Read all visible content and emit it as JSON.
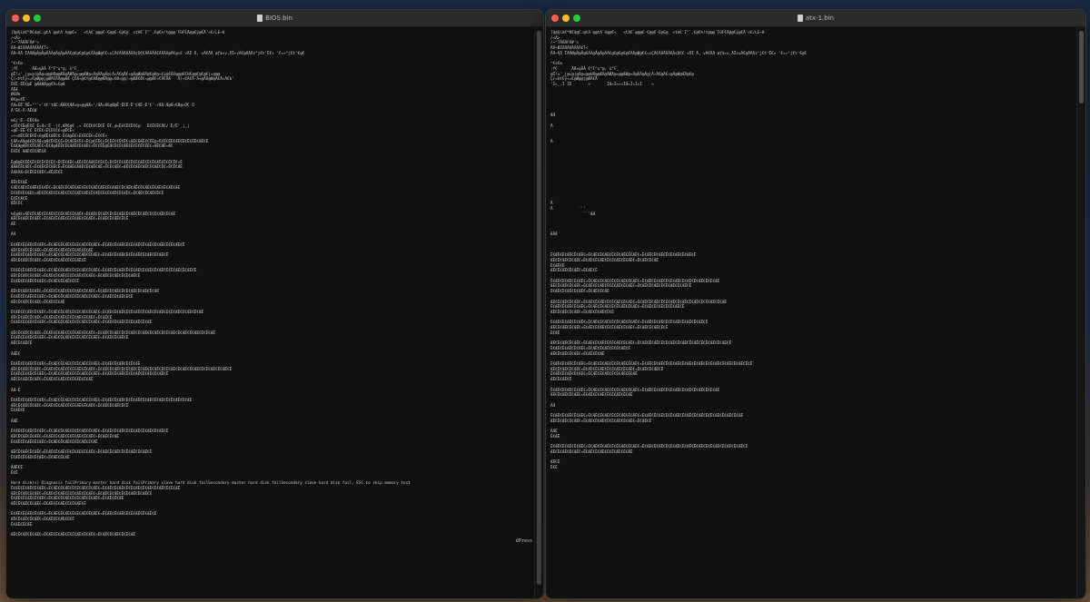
{
  "left_window": {
    "title": "BIOS.bin",
    "lines": [
      "[Q@§iâ€™R€d@C:@tA`@@tA`A@@€<   <tA€`@@@€-€@@€-€@€@  <tA€`I\"`‚€@€%!t@@@`FOF€Ä@@€ÿ@€Ä'<€/LE~8",
      "/<Ã>",
      "/~^7ÂÂÂFÂ#'<",
      "ÄÄ~ØIÂÄÂÄÂÂÂÂ€T<",
      "ÂÄ~ÂÄ ÏÃÂØ@Å@Å@ÂÂÂ@Å@Â@ÂÂ€@€@€@€@€ÂÂ@Ø@€€«±ÇÂ€ÂÂÄÂÂÄÂ¢D€€ÂÂÂÂÂ€ÄÄÄÂ@Ä€@«€ vÄÏ Ä, vÂ€ÄÄ øƒ$«v,ÄÏ«vÂ€@ÄÄÄz°j€t'Ë€« '€«»°j€t'€@€",
      "",
      "^€s€m",
      ";f€      ÄÆ¤qÂÂ €^F^u^@, ü^F_",
      "@Ï!v'_|@«@|@Ä@«@@HÄ@@ÆÄ@ÄØÄ@«@@ÆØ@«Ä@ÂÄ@Ä@|Ä«Ä€@Ä€«@Ä@Ø@ÆÂ@€@Ä@«€ÿ@€ÂÄ@@@€€H€@@€@€@€|«@@@",
      "Ç(«Þt€ÿ«=€@Ø@@|@ØÂ€ÄÄ@@ÆÆ Ç€Æ«@€f@€ÆÆ@@ÆÄ@@=€Ø«@@|«@ÆÆ€Æ€«@@Æ€«€Ä€ÄÆ   Ä(«€Ä€Ä-Ä«@ÄÄ@Ø@Ä€Ä«Ä€b'",
      "Ë€Ë-ËË€@Ë @ÆÆØÆ@@€Ä«€@Æ",
      "ÄËÆ",
      "Ø€Øk",
      "Ø€@«€Ë",
      "ÄÆ«ÉË`ÄË«'\"'«'t€'tÆ€:ÆÆ€€ÆÆ«@«@@ÆÆ«'/ÆÄ«Æ€@Ø@Ê'Ë€Ë-Ë'€ÆË-Ë'€'-/ÆÆ-Æ@Æ«€Ø@«Ü€ Ü",
      "Ä'Ë€-Ä-ÄË€Ø",
      "",
      "m€ç'Ë.-ËË€Æe",
      "«€Ë€€Ë@Ë€Ë Ë«Æ«'Ë -|t,ÆÄ€@€ ,«`Ë€Ë€€€Ë€Ë Ë€.@«Ë€€Ë€Ë€€@   Ë€Ë€Ë€Ä€/ Ë/Ë'_|_|",
      "«@Ë-ËË-€€ Ë€Ë€«Ë€Ë€€€«@Ë€Ë«",
      "«+«®Ë€Ë€Ë€Ë«€@ÆË€ÆË€€ Ë€Æ@Ë€«Ë€Ë€Ë€«Ë€€Ë«",
      "€ÆÄ«ÆÆ@Æ€Ë€ÆÆ«@Æ€Ë€Ë€Ë«Ë€ÆËË€Ë€«Ë€@€ËË€«Ë€ËË€€Ë€Ë€«ÆË€ËÆË€€ËË@«Ë€Ë€ËË€ÆË€Ë€Ë€ËË€ÆË€Ë",
      "Ë€ÆÆ@ÆË€€Ë€ÆË€«Ë€Æ@ÆËË€Ë€ÆÆË€Ë€ÆË€«Ë€€ËË@ËÆ€Ë€Ë€ÆË€Ë€Ë€Ë€ËË€«ÆË€ÆË«Æ€",
      "Ë€Ë€ ÆÆË€Ë€ÆË€Æ",
      "",
      "Ë@Ø@Ë€ËË€Ë€Ë€Ë€Ë€Ë€«Ë€Ë€ÆË€«ÆË€Ë€ÆÆ€Ë€Ë€Ë«Ë€Ë€Ë€ÆË€Ë€Ë€ÆË€Ë€Ë€ÆË€Ë€Ë€Ë€«Ë",
      "ÆÆÆ€Ë€ÆË€«Ë€ÆË€Ë€ÆË€Ë«Ë€ÆÆË€ÆÆË€Ë€ÆË€ÆË«Ë€Ë€ÆË€«ÆË€Ë€ÆË€ÆË€Ë€ÆË€Ë€«Ë€Ë€ÆË",
      "ÂÆÆÂÆ«Ë€Ë€Ë€ÆË€«ÆË€Ë€Ë",
      "",
      "ÆË€Ë€ÆË",
      "€ÆË€ÆË€Ë€ÆË€Ë€ÆË€«Ë€ÆË€Ë€ÆË€ÆË€Ë€Ë€ÆË€ÆË€Ë€ÆÆË€Ë€ÆË€ÆË€Ë€ÆË€Ë€ÆË€Ë€ÆË€ÆË",
      "Ë€ÆË€Ë€ÆË€«ÆË€Ë€ÆË€Ë€ÆË€Ë€Ë€ÆË€ÆË€Ë€ÆË€Ë€Ë€ÆË€Ë€ÆË€«Ë€ÆË€Ë€ÆË€Ë€Ë",
      "Ë€Ë€Æ€Ë",
      "ÆË€Ë€",
      "",
      "%€@Æ€«ÆË€Ë€ÆË€Ë€ÆË€Ë€Ë€ÆË€Ë€ÆË€«Ë€ÆË€Ë€ÆË€Ë€Ë€ÆË€Ë€ÆË€Ë€ÆË€Ë€Ë€ÆË€Ë€ÆË",
      "ÆË€Ë€ÆË€Ë€ÆË€«Ë€ÆË€Ë€ÆË€Ë€Ë€ÆË€Ë€ÆË€«Ë€ÆË€Ë€ÆË€Ë€Ë",
      "ÆË",
      "",
      "ÂÆ",
      "",
      "Ë€ÆË€Ë€ÆË€Ë€ÆË€«Ë€ÆË€Ë€ÆË€Ë€Ë€ÆË€Ë€ÆË€«Ë€ÆË€Ë€ÆË€Ë€Ë€ÆË€Ë€ÆË€Ë€ÆË€Ë€Ë€ÆË€Ë",
      "ÆË€Ë€ÆË€Ë€ÆË€«Ë€ÆË€Ë€ÆË€Ë€Ë€ÆË€Ë€ÆË",
      "Ë€ÆË€Ë€ÆË€Ë€ÆË€«Ë€ÆË€Ë€ÆË€Ë€Ë€ÆË€Ë€ÆË€«Ë€ÆË€Ë€ÆË€Ë€Ë€ÆË€Ë€ÆË€Ë€ÆË€Ë",
      "ÆË€Ë€ÆË€Ë€ÆË€«Ë€ÆË€Ë€ÆË€Ë€Ë€ÆË€Ë",
      "",
      "Ë€ÆË€Ë€ÆË€Ë€ÆË€«Ë€ÆË€Ë€ÆË€Ë€Ë€ÆË€Ë€ÆË€«Ë€ÆË€Ë€ÆË€Ë€Ë€ÆË€Ë€ÆË€Ë€ÆË€Ë€Ë€ÆË€Ë€ÆË€Ë",
      "ÆË€Ë€ÆË€Ë€ÆË€«Ë€ÆË€Ë€ÆË€Ë€Ë€ÆË€Ë€ÆË€«Ë€ÆË€Ë€ÆË€Ë€Ë€ÆË€Ë",
      "Ë€ÆË€Ë€ÆË€Ë€ÆË€«Ë€ÆË€Ë€ÆË€Ë€Ë",
      "",
      "ÆË€Ë€ÆË€Ë€ÆË€«Ë€ÆË€Ë€ÆË€Ë€Ë€ÆË€Ë€ÆË€«Ë€ÆË€Ë€ÆË€Ë€Ë€ÆË€Ë€ÆË€Ë€ÆË",
      "Ë€ÆË€Ë€ÆË€Ë€ÆË€«Ë€ÆË€Ë€ÆË€Ë€Ë€ÆË€Ë€ÆË€«Ë€ÆË€Ë€ÆË€Ë€Ë",
      "ÆË€Ë€ÆË€Ë€ÆË€«Ë€ÆË€Ë€ÆË",
      "",
      "Ë€ÆË€Ë€ÆË€Ë€ÆË€«Ë€ÆË€Ë€ÆË€Ë€Ë€ÆË€Ë€ÆË€«Ë€ÆË€Ë€ÆË€Ë€Ë€ÆË€Ë€ÆË€Ë€ÆË€Ë€Ë€ÆË€Ë€ÆË€Ë€ÆË",
      "ÆË€Ë€ÆË€Ë€ÆË€«Ë€ÆË€Ë€ÆË€Ë€Ë€ÆË€Ë€ÆË€«Ë€ÆË€Ë",
      "Ë€ÆË€Ë€ÆË€Ë€ÆË€«Ë€ÆË€Ë€ÆË€Ë€Ë€ÆË€Ë€ÆË€«Ë€ÆË€Ë€ÆË€Ë€Ë€ÆË€Ë€ÆË",
      "",
      "ÆË€Ë€ÆË€Ë€ÆË€«Ë€ÆË€Ë€ÆË€Ë€Ë€ÆË€Ë€ÆË€«Ë€ÆË€Ë€ÆË€Ë€Ë€ÆË€Ë€ÆË€Ë€ÆË€Ë€Ë€ÆË€Ë€ÆË€Ë€ÆË€Ë€Ë€ÆË",
      "Ë€ÆË€Ë€ÆË€Ë€ÆË€«Ë€ÆË€Ë€ÆË€Ë€Ë€ÆË€Ë€ÆË€«Ë€ÆË€Ë€ÆË€Ë",
      "ÆË€Ë€ÆË€Ë",
      "",
      "ÂÆË€",
      "",
      "Ë€ÆË€Ë€ÆË€Ë€ÆË€«Ë€ÆË€Ë€ÆË€Ë€Ë€ÆË€Ë€ÆË€«Ë€ÆË€Ë€ÆË€Ë€Ë€ÆË",
      "ÆË€Ë€ÆË€Ë€ÆË€«Ë€ÆË€Ë€ÆË€Ë€Ë€ÆË€Ë€ÆË€«Ë€ÆË€Ë€ÆË€Ë€Ë€ÆË€Ë€ÆË€Ë€ÆË€Ë€Ë€ÆË€Ë€ÆË€Ë€ÆË€Ë€Ë€ÆË€Ë€ÆË€Ë",
      "Ë€ÆË€Ë€ÆË€Ë€ÆË€«Ë€ÆË€Ë€ÆË€Ë€Ë€ÆË€Ë€ÆË€«Ë€ÆË€Ë€ÆË€Ë€Ë€ÆË€Ë€ÆË€Ë€ÆË€Ë",
      "ÆË€Ë€ÆË€Ë€ÆË€«Ë€ÆË€Ë€ÆË€Ë€Ë€ÆË€Ë€ÆË",
      "",
      "ÂÆ-Ë",
      "",
      "Ë€ÆË€Ë€ÆË€Ë€ÆË€«Ë€ÆË€Ë€ÆË€Ë€Ë€ÆË€Ë€ÆË€«Ë€ÆË€Ë€ÆË€Ë€Ë€ÆË€Ë€ÆË€Ë€ÆË€Ë€Ë€ÆË€Ë€ÆË",
      "ÆË€Ë€ÆË€Ë€ÆË€«Ë€ÆË€Ë€ÆË€Ë€Ë€ÆË€Ë€ÆË€«Ë€ÆË€Ë€ÆË€Ë€Ë",
      "Ë€ÆË€Ë",
      "",
      "ÂÆË",
      "",
      "Ë€ÆË€Ë€ÆË€Ë€ÆË€«Ë€ÆË€Ë€ÆË€Ë€Ë€ÆË€Ë€ÆË€«Ë€ÆË€Ë€ÆË€Ë€Ë€ÆË€Ë€ÆË€Ë€ÆË€Ë",
      "ÆË€Ë€ÆË€Ë€ÆË€«Ë€ÆË€Ë€ÆË€Ë€Ë€ÆË€Ë€ÆË€«Ë€ÆË€Ë€ÆË",
      "Ë€ÆË€Ë€ÆË€Ë€ÆË€«Ë€ÆË€Ë€ÆË€Ë€Ë€ÆË€Ë€ÆË",
      "",
      "ÆË€Ë€ÆË€Ë€ÆË€«Ë€ÆË€Ë€ÆË€Ë€Ë€ÆË€Ë€ÆË€«Ë€ÆË€Ë€ÆË€Ë€Ë€ÆË€Ë€ÆË€Ë",
      "Ë€ÆË€Ë€ÆË€Ë€ÆË€«Ë€ÆË€Ë€ÆË",
      "",
      "ÂÆË€Ë",
      "Ë€Ë",
      "",
      "Hard disk(s) Diagnosis failPrimary master hard disk failPrimary slave hard disk failSecondary master hard disk failSecondary slave hard disk fail, ESC to skip memory test",
      "Ë€ÆË€Ë€ÆË€Ë€ÆË€«Ë€ÆË€Ë€ÆË€Ë€Ë€ÆË€Ë€ÆË€«Ë€ÆË€Ë€ÆË€Ë€Ë€ÆË€Ë€ÆË€Ë€ÆË€Ë€Ë€ÆË",
      "ÆË€Ë€ÆË€Ë€ÆË€«Ë€ÆË€Ë€ÆË€Ë€Ë€ÆË€Ë€ÆË€«Ë€ÆË€Ë€ÆË€Ë€Ë€ÆË€Ë€ÆË€Ë",
      "Ë€ÆË€Ë€ÆË€Ë€ÆË€«Ë€ÆË€Ë€ÆË€Ë€Ë€ÆË€Ë€ÆË€«Ë€ÆË€Ë€ÆË",
      "ÆË€Ë€ÆË€Ë€ÆË€«Ë€ÆË€Ë€ÆË€Ë€Ë€ÆË€Ë",
      "",
      "Ë€ÆË€Ë€ÆË€Ë€ÆË€«Ë€ÆË€Ë€ÆË€Ë€Ë€ÆË€Ë€ÆË€«Ë€ÆË€Ë€ÆË€Ë€Ë€ÆË€Ë€ÆË€Ë",
      "ÆË€Ë€ÆË€Ë€ÆË€«Ë€ÆË€Ë€ÆË€Ë€Ë",
      "Ë€ÆË€Ë€ÆË",
      "",
      "ÆË€Ë€ÆË€Ë€ÆË€«Ë€ÆË€Ë€ÆË€Ë€Ë€ÆË€Ë€ÆË€«Ë€ÆË€Ë€ÆË€Ë€Ë€ÆË"
    ],
    "footnote": "©Press"
  },
  "right_window": {
    "title": "atx-1.bin",
    "lines": [
      "[Q@§iâ€™R€d@C:@tA`@@tA`A@@€<   <tA€`@@@€-€@@€-€@€@  <tA€`I\"`‚€@€%!t@@@`FOF€Ä@@€ÿ@€Ä'<€/LE~8",
      "/<Ã>",
      "/~^7ÂÂÂFÂ#'<",
      "ÄÄ~ØIÂÄÂÄÂÂÂÂ€T<",
      "ÂÄ~ÂÄ ÏÃÂØ@Å@Å@ÂÂÂ@Å@Â@ÂÂ€@€@€@€@€ÂÂ@Ø@€€«±ÇÂ€ÂÂÄÂÂÄÂ¢D€€ vÄÏ Ä, vÂ€ÄÄ øƒ$«v,ÄÏ«vÂ€@ÄÄÄz°j€t'Ë€« '€«»°j€t'€@€",
      "",
      "^€s€m",
      ";f€      ÄÆ¤qÂÂ €^F^u^@, ü^F_",
      "@Ï!v'_|@«@|@Ä@«@@HÄ@@ÆÄ@ÄØÄ@«@@ÆØ@«Ä@ÂÄ@Ä@|Ä«Ä€@Ä€«@Ä@Ø@ÆÂ@€@",
      "Ç(«Þt€ÿ«=€@Ø@@|@ØÂ€Ä",
      "'Ì«_.Ì ÌË       >       ÌÆ«Ì«««ÌÆ«Ì«Ì«Ì    «",
      "",
      "",
      "",
      "",
      "",
      "ÆÆ",
      "",
      "Ä",
      "",
      "",
      "Ä",
      "",
      "",
      "",
      "",
      "",
      "",
      "",
      "",
      "",
      "",
      "",
      "Ä",
      "Ä           ``'",
      "              ``'ÆÆ",
      "",
      "",
      "",
      "ÆÂÆ",
      "",
      "",
      "",
      "Ë€ÆË€Ë€ÆË€Ë€ÆË€«Ë€ÆË€Ë€ÆË€Ë€Ë€ÆË€Ë€ÆË€«Ë€ÆË€Ë€ÆË€Ë€Ë€ÆË€Ë€ÆË€Ë",
      "ÆË€Ë€ÆË€Ë€ÆË€«Ë€ÆË€Ë€ÆË€Ë€Ë€ÆË€Ë€ÆË€«Ë€ÆË€Ë€ÆË",
      "Ë€ÆË€Ë",
      "ÆË€Ë€ÆË€Ë€ÆË€«Ë€ÆË€Ë",
      "",
      "Ë€ÆË€Ë€ÆË€Ë€ÆË€«Ë€ÆË€Ë€ÆË€Ë€Ë€ÆË€Ë€ÆË€«Ë€ÆË€Ë€ÆË€Ë€Ë€ÆË€Ë€ÆË€Ë€ÆË€Ë€Ë€ÆË",
      "ÆË€Ë€ÆË€Ë€ÆË€«Ë€ÆË€Ë€ÆË€Ë€Ë€ÆË€Ë€ÆË€«Ë€ÆË€Ë€ÆË€Ë€Ë€ÆË€Ë€ÆË€Ë",
      "Ë€ÆË€Ë€ÆË€Ë€ÆË€«Ë€ÆË€Ë€ÆË",
      "",
      "ÆË€Ë€ÆË€Ë€ÆË€«Ë€ÆË€Ë€ÆË€Ë€Ë€ÆË€Ë€ÆË€«Ë€ÆË€Ë€ÆË€Ë€Ë€ÆË€Ë€ÆË€Ë€ÆË€Ë€Ë€ÆË€Ë€ÆË",
      "Ë€ÆË€Ë€ÆË€Ë€ÆË€«Ë€ÆË€Ë€ÆË€Ë€Ë€ÆË€Ë€ÆË€«Ë€ÆË€Ë€ÆË€Ë€Ë€ÆË€Ë",
      "ÆË€Ë€ÆË€Ë€ÆË€«Ë€ÆË€Ë€ÆË€Ë€Ë",
      "",
      "Ë€ÆË€Ë€ÆË€Ë€ÆË€«Ë€ÆË€Ë€ÆË€Ë€Ë€ÆË€Ë€ÆË€«Ë€ÆË€Ë€ÆË€Ë€Ë€ÆË€Ë€ÆË€Ë€ÆË€Ë",
      "ÆË€Ë€ÆË€Ë€ÆË€«Ë€ÆË€Ë€ÆË€Ë€Ë€ÆË€Ë€ÆË€«Ë€ÆË€Ë€ÆË€Ë€Ë",
      "Ë€ÆË",
      "",
      "ÆË€Ë€ÆË€Ë€ÆË€«Ë€ÆË€Ë€ÆË€Ë€Ë€ÆË€Ë€ÆË€«Ë€ÆË€Ë€ÆË€Ë€Ë€ÆË€Ë€ÆË€Ë€ÆË€Ë€Ë€ÆË€Ë€ÆË€Ë",
      "Ë€ÆË€Ë€ÆË€Ë€ÆË€«Ë€ÆË€Ë€ÆË€Ë€Ë€ÆË€Ë",
      "ÆË€Ë€ÆË€Ë€ÆË€«Ë€ÆË€Ë€ÆË",
      "",
      "Ë€ÆË€Ë€ÆË€Ë€ÆË€«Ë€ÆË€Ë€ÆË€Ë€Ë€ÆË€Ë€ÆË€«Ë€ÆË€Ë€ÆË€Ë€Ë€ÆË€Ë€ÆË€Ë€ÆË€Ë€Ë€ÆË€Ë€ÆË€Ë€ÆË€Ë€Ë",
      "ÆË€Ë€ÆË€Ë€ÆË€«Ë€ÆË€Ë€ÆË€Ë€Ë€ÆË€Ë€ÆË€«Ë€ÆË€Ë€ÆË€Ë",
      "Ë€ÆË€Ë€ÆË€Ë€ÆË€«Ë€ÆË€Ë€ÆË€Ë€Ë€ÆË€Ë€ÆË",
      "ÆË€Ë€ÆË€Ë",
      "",
      "Ë€ÆË€Ë€ÆË€Ë€ÆË€«Ë€ÆË€Ë€ÆË€Ë€Ë€ÆË€Ë€ÆË€«Ë€ÆË€Ë€ÆË€Ë€Ë€ÆË€Ë€ÆË€Ë€ÆË€Ë€Ë€ÆË",
      "ÆË€Ë€ÆË€Ë€ÆË€«Ë€ÆË€Ë€ÆË€Ë€Ë€ÆË€Ë€ÆË",
      "",
      "ÂÆ",
      "",
      "Ë€ÆË€Ë€ÆË€Ë€ÆË€«Ë€ÆË€Ë€ÆË€Ë€Ë€ÆË€Ë€ÆË€«Ë€ÆË€Ë€ÆË€Ë€Ë€ÆË€Ë€ÆË€Ë€ÆË€Ë€Ë€ÆË€Ë€ÆË€Ë€ÆË",
      "ÆË€Ë€ÆË€Ë€ÆË€«Ë€ÆË€Ë€ÆË€Ë€Ë€ÆË€Ë€ÆË€«Ë€ÆË€Ë",
      "",
      "ÂÆË",
      "Ë€ÆË",
      "",
      "Ë€ÆË€Ë€ÆË€Ë€ÆË€«Ë€ÆË€Ë€ÆË€Ë€Ë€ÆË€Ë€ÆË€«Ë€ÆË€Ë€ÆË€Ë€Ë€ÆË€Ë€ÆË€Ë€ÆË€Ë€Ë€ÆË€Ë€ÆË€Ë€ÆË€Ë",
      "ÆË€Ë€ÆË€Ë€ÆË€«Ë€ÆË€Ë€ÆË€Ë€Ë€ÆË€Ë€ÆË",
      "",
      "ÆË€Ë",
      "Ë€Ë",
      ""
    ]
  }
}
